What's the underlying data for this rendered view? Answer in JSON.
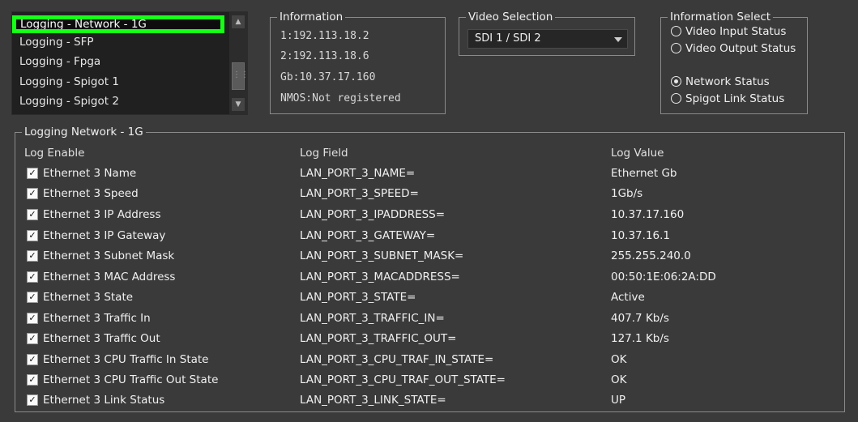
{
  "log_list": {
    "items": [
      {
        "label": "Logging - Network - 1G",
        "selected": true
      },
      {
        "label": "Logging - SFP",
        "selected": false
      },
      {
        "label": "Logging - Fpga",
        "selected": false
      },
      {
        "label": "Logging - Spigot 1",
        "selected": false
      },
      {
        "label": "Logging - Spigot 2",
        "selected": false
      }
    ]
  },
  "information": {
    "title": "Information",
    "lines": [
      "1:192.113.18.2",
      "2:192.113.18.6",
      "Gb:10.37.17.160",
      "NMOS:Not registered"
    ]
  },
  "video_selection": {
    "title": "Video Selection",
    "value": "SDI 1 / SDI 2"
  },
  "information_select": {
    "title": "Information Select",
    "options": [
      {
        "label": "Video Input Status",
        "checked": false
      },
      {
        "label": "Video Output Status",
        "checked": false
      },
      {
        "label": "Network Status",
        "checked": true
      },
      {
        "label": "Spigot Link Status",
        "checked": false
      }
    ]
  },
  "logging_panel": {
    "title": "Logging Network - 1G",
    "headers": {
      "enable": "Log Enable",
      "field": "Log Field",
      "value": "Log Value"
    },
    "rows": [
      {
        "enabled": true,
        "name": "Ethernet 3 Name",
        "field": "LAN_PORT_3_NAME=",
        "value": "Ethernet Gb"
      },
      {
        "enabled": true,
        "name": "Ethernet 3 Speed",
        "field": "LAN_PORT_3_SPEED=",
        "value": "1Gb/s"
      },
      {
        "enabled": true,
        "name": "Ethernet 3 IP Address",
        "field": "LAN_PORT_3_IPADDRESS=",
        "value": "10.37.17.160"
      },
      {
        "enabled": true,
        "name": "Ethernet 3 IP Gateway",
        "field": "LAN_PORT_3_GATEWAY=",
        "value": "10.37.16.1"
      },
      {
        "enabled": true,
        "name": "Ethernet 3 Subnet Mask",
        "field": "LAN_PORT_3_SUBNET_MASK=",
        "value": "255.255.240.0"
      },
      {
        "enabled": true,
        "name": "Ethernet 3 MAC Address",
        "field": "LAN_PORT_3_MACADDRESS=",
        "value": "00:50:1E:06:2A:DD"
      },
      {
        "enabled": true,
        "name": "Ethernet 3 State",
        "field": "LAN_PORT_3_STATE=",
        "value": "Active"
      },
      {
        "enabled": true,
        "name": "Ethernet 3 Traffic In",
        "field": "LAN_PORT_3_TRAFFIC_IN=",
        "value": "407.7 Kb/s"
      },
      {
        "enabled": true,
        "name": "Ethernet 3 Traffic Out",
        "field": "LAN_PORT_3_TRAFFIC_OUT=",
        "value": "127.1 Kb/s"
      },
      {
        "enabled": true,
        "name": "Ethernet 3 CPU Traffic In State",
        "field": "LAN_PORT_3_CPU_TRAF_IN_STATE=",
        "value": "OK"
      },
      {
        "enabled": true,
        "name": "Ethernet 3 CPU Traffic Out State",
        "field": "LAN_PORT_3_CPU_TRAF_OUT_STATE=",
        "value": "OK"
      },
      {
        "enabled": true,
        "name": "Ethernet 3 Link Status",
        "field": "LAN_PORT_3_LINK_STATE=",
        "value": "UP"
      }
    ]
  },
  "colors": {
    "background": "#3a3a3a",
    "highlight": "#16ff16",
    "list_bg": "#202020"
  },
  "icons": {
    "scroll_up": "scroll-up-icon",
    "scroll_down": "scroll-down-icon",
    "grip": "grip-icon",
    "checkbox": "checkmark-icon"
  }
}
